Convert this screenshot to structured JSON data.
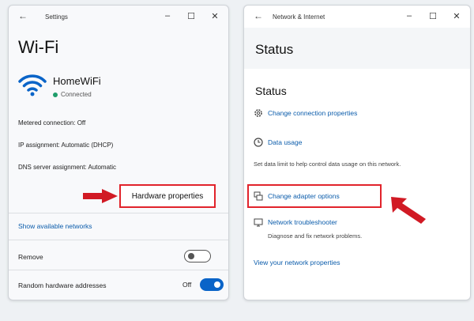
{
  "left": {
    "window_title": "Settings",
    "back_glyph": "←",
    "controls": [
      "–",
      "☐",
      "✕"
    ],
    "heading": "Wi-Fi",
    "network_name": "HomeWiFi",
    "network_status": "Connected",
    "metered": "Metered connection: Off",
    "ip": "IP assignment: Automatic (DHCP)",
    "dns": "DNS server assignment: Automatic",
    "hardware_button": "Hardware properties",
    "show_networks": "Show available networks",
    "remove_label": "Remove",
    "random_label": "Random hardware addresses",
    "random_state": "Off"
  },
  "right": {
    "window_title": "Network & Internet",
    "back_glyph": "←",
    "controls": [
      "–",
      "☐",
      "✕"
    ],
    "header_title": "Status",
    "section_title": "Status",
    "change_connection": "Change connection properties",
    "data_usage": "Data usage",
    "data_usage_desc": "Set data limit to help control data usage on this network.",
    "change_adapter": "Change adapter options",
    "troubleshooter": "Network troubleshooter",
    "troubleshooter_desc": "Diagnose and fix network problems.",
    "view_properties": "View your network properties"
  },
  "colors": {
    "accent": "#0a64c8",
    "link": "#0b5cab",
    "highlight": "#e1232b",
    "connected": "#1f9d6b"
  },
  "icons": [
    "back-arrow-icon",
    "minimize-icon",
    "maximize-icon",
    "close-icon",
    "wifi-icon",
    "gear-icon",
    "clock-icon",
    "adapter-icon",
    "troubleshoot-icon",
    "red-arrow-icon"
  ]
}
